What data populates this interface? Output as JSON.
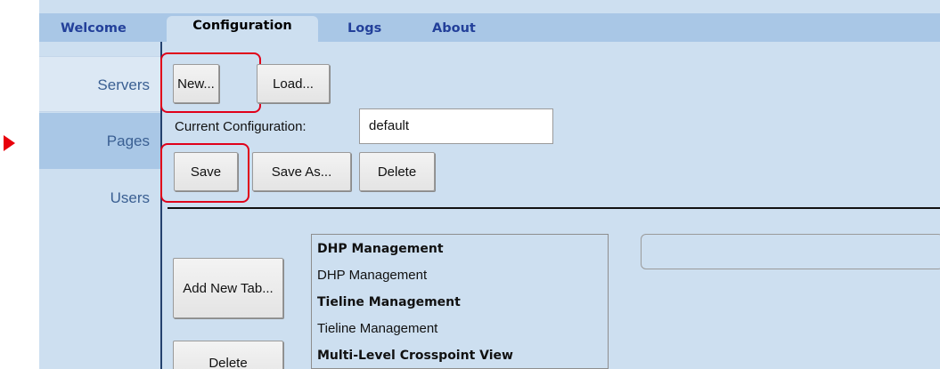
{
  "tabs": [
    {
      "label": "Welcome",
      "active": false
    },
    {
      "label": "Configuration",
      "active": true
    },
    {
      "label": "Logs",
      "active": false
    },
    {
      "label": "About",
      "active": false
    }
  ],
  "sidebar": {
    "items": [
      {
        "label": "Servers",
        "selected": false
      },
      {
        "label": "Pages",
        "selected": true
      },
      {
        "label": "Users",
        "selected": false
      }
    ]
  },
  "config": {
    "new_label": "New...",
    "load_label": "Load...",
    "current_label": "Current Configuration:",
    "current_value": "default",
    "save_label": "Save",
    "save_as_label": "Save As...",
    "delete_label": "Delete"
  },
  "pages": {
    "add_tab_label": "Add New Tab...",
    "delete_tab_label": "Delete",
    "list": [
      {
        "label": "DHP Management",
        "header": true
      },
      {
        "label": "DHP Management",
        "header": false
      },
      {
        "label": "Tieline Management",
        "header": true
      },
      {
        "label": "Tieline Management",
        "header": false
      },
      {
        "label": "Multi-Level Crosspoint View",
        "header": true
      }
    ]
  },
  "colors": {
    "background": "#cddff0",
    "tab_bar": "#a9c7e6",
    "tab_text": "#23409a",
    "highlight": "#e0001a"
  }
}
